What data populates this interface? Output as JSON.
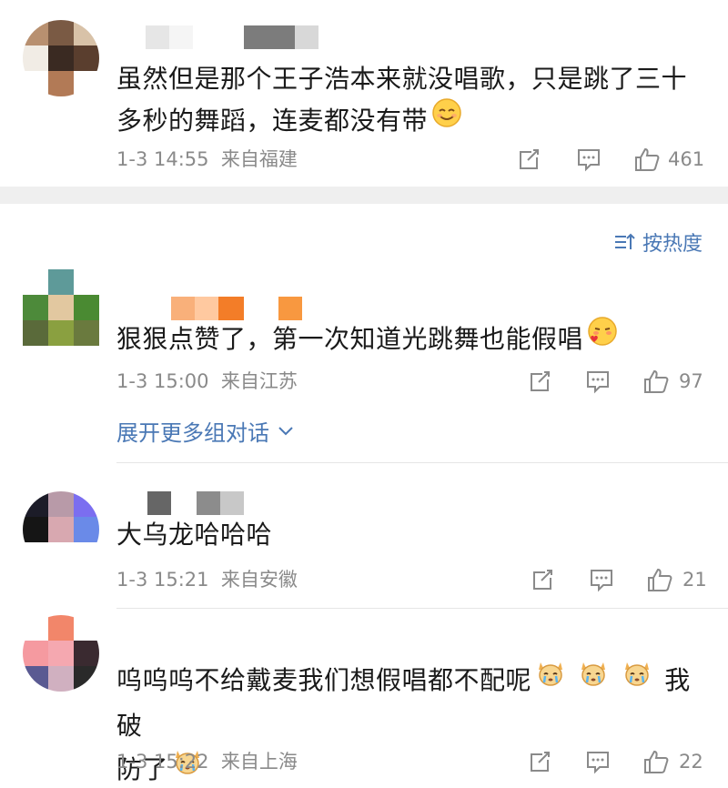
{
  "comments": [
    {
      "text": "虽然但是那个王子浩本来就没唱歌，只是跳了三十多秒的舞蹈，连麦都没有带",
      "date": "1-3 14:55",
      "location": "来自福建",
      "likes": "461",
      "emoji": "smile-emoji"
    },
    {
      "text": "狠狠点赞了，第一次知道光跳舞也能假唱",
      "date": "1-3 15:00",
      "location": "来自江苏",
      "likes": "97",
      "emoji": "blush-kiss-emoji"
    },
    {
      "text": "大乌龙哈哈哈",
      "date": "1-3 15:21",
      "location": "来自安徽",
      "likes": "21"
    },
    {
      "text_line1": "呜呜呜不给戴麦我们想假唱都不配呢",
      "text_mid": "我破",
      "text_line2": "防了",
      "date": "1-3 15:22",
      "location": "来自上海",
      "likes": "22",
      "emoji": "crying-dog-emoji"
    }
  ],
  "sort_label": "按热度",
  "expand_label": "展开更多组对话",
  "colors": {
    "link": "#4a78b5",
    "meta": "#8a8a8a",
    "divider": "#efefef"
  }
}
